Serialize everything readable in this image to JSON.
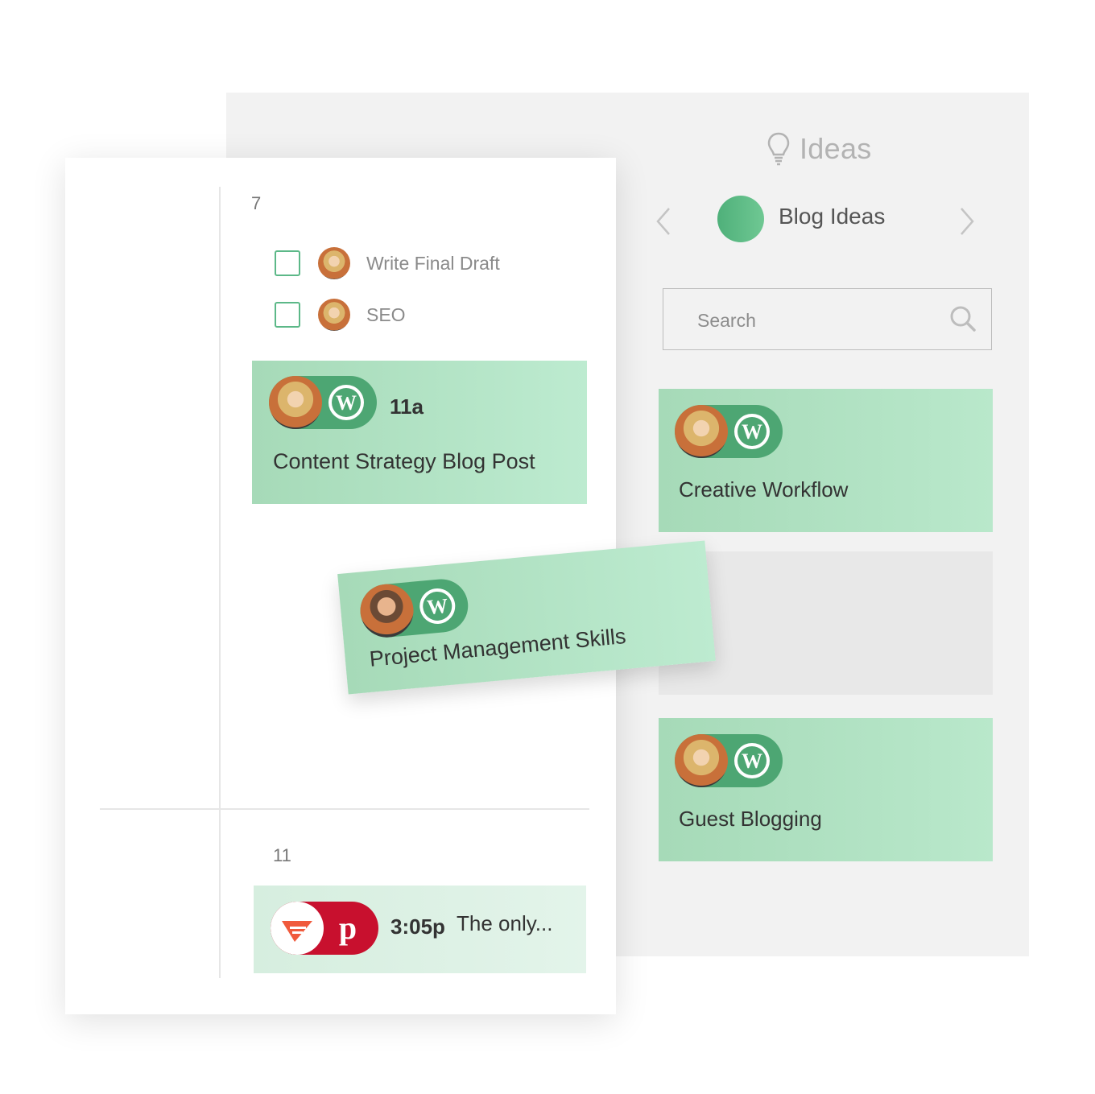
{
  "ideas": {
    "title": "Ideas",
    "category": "Blog Ideas",
    "search_placeholder": "Search",
    "cards": [
      {
        "title": "Creative Workflow"
      },
      {
        "title": "Guest Blogging"
      }
    ]
  },
  "calendar": {
    "day_top": "7",
    "day_bottom": "11",
    "tasks": [
      {
        "label": "Write Final Draft"
      },
      {
        "label": "SEO"
      }
    ],
    "post": {
      "time": "11a",
      "title": "Content Strategy Blog Post"
    },
    "dragged": {
      "title": "Project Management Skills"
    },
    "pin": {
      "time": "3:05p",
      "text": "The only..."
    }
  },
  "colors": {
    "card_green": "#a6dab8",
    "pill_green": "#4da673",
    "pinterest_red": "#c8102e",
    "checkbox_green": "#5cb888"
  }
}
